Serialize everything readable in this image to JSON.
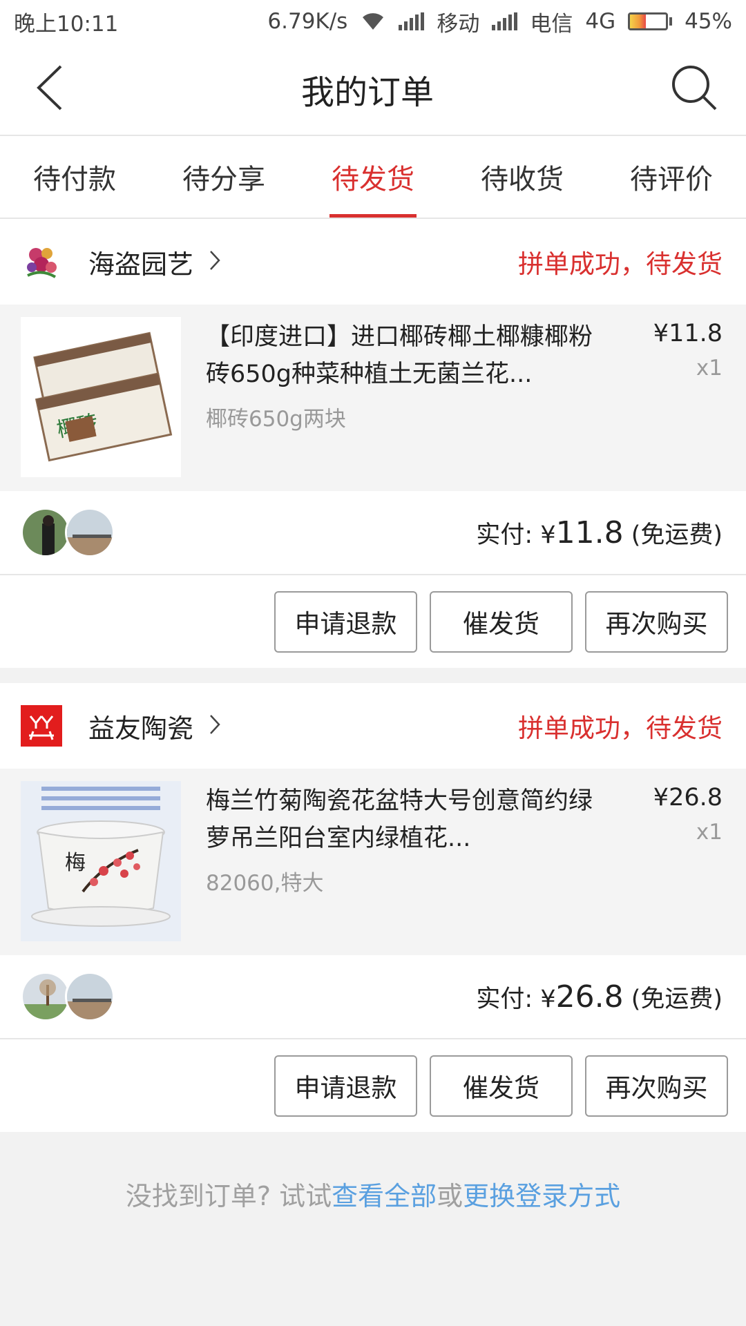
{
  "status": {
    "time": "晚上10:11",
    "speed": "6.79K/s",
    "carrier1": "移动",
    "carrier2": "电信",
    "network": "4G",
    "battery": "45%",
    "battery_level": 0.45
  },
  "nav": {
    "title": "我的订单",
    "back_icon": "chevron-left-icon",
    "search_icon": "search-icon"
  },
  "tabs": [
    {
      "label": "待付款",
      "active": false
    },
    {
      "label": "待分享",
      "active": false
    },
    {
      "label": "待发货",
      "active": true
    },
    {
      "label": "待收货",
      "active": false
    },
    {
      "label": "待评价",
      "active": false
    }
  ],
  "orders": [
    {
      "shop": "海盗园艺",
      "status": "拼单成功，待发货",
      "product": {
        "title": "【印度进口】进口椰砖椰土椰糠椰粉砖650g种菜种植土无菌兰花...",
        "spec": "椰砖650g两块",
        "price": "¥11.8",
        "qty": "x1",
        "image_text": "椰砖"
      },
      "pay_label": "实付: ",
      "pay_currency": "¥",
      "pay_amount": "11.8",
      "pay_note": " (免运费)",
      "buttons": [
        "申请退款",
        "催发货",
        "再次购买"
      ]
    },
    {
      "shop": "益友陶瓷",
      "status": "拼单成功，待发货",
      "product": {
        "title": "梅兰竹菊陶瓷花盆特大号创意简约绿萝吊兰阳台室内绿植花...",
        "spec": "82060,特大",
        "price": "¥26.8",
        "qty": "x1",
        "image_text": "梅"
      },
      "pay_label": "实付: ",
      "pay_currency": "¥",
      "pay_amount": "26.8",
      "pay_note": " (免运费)",
      "buttons": [
        "申请退款",
        "催发货",
        "再次购买"
      ]
    }
  ],
  "footer": {
    "prefix": "没找到订单? 试试",
    "link1": "查看全部",
    "middle": "或",
    "link2": "更换登录方式"
  },
  "colors": {
    "accent": "#d9302f",
    "link": "#5aa0e0"
  }
}
